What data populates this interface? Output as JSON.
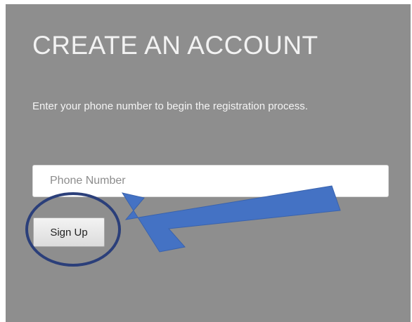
{
  "form": {
    "title": "CREATE AN ACCOUNT",
    "description": "Enter your phone number to begin the registration process.",
    "phone_placeholder": "Phone Number",
    "signup_label": "Sign Up"
  },
  "annotation": {
    "highlight_color": "#2b3f7a",
    "arrow_color": "#4472c4",
    "panel_color": "#8e8e8e"
  }
}
